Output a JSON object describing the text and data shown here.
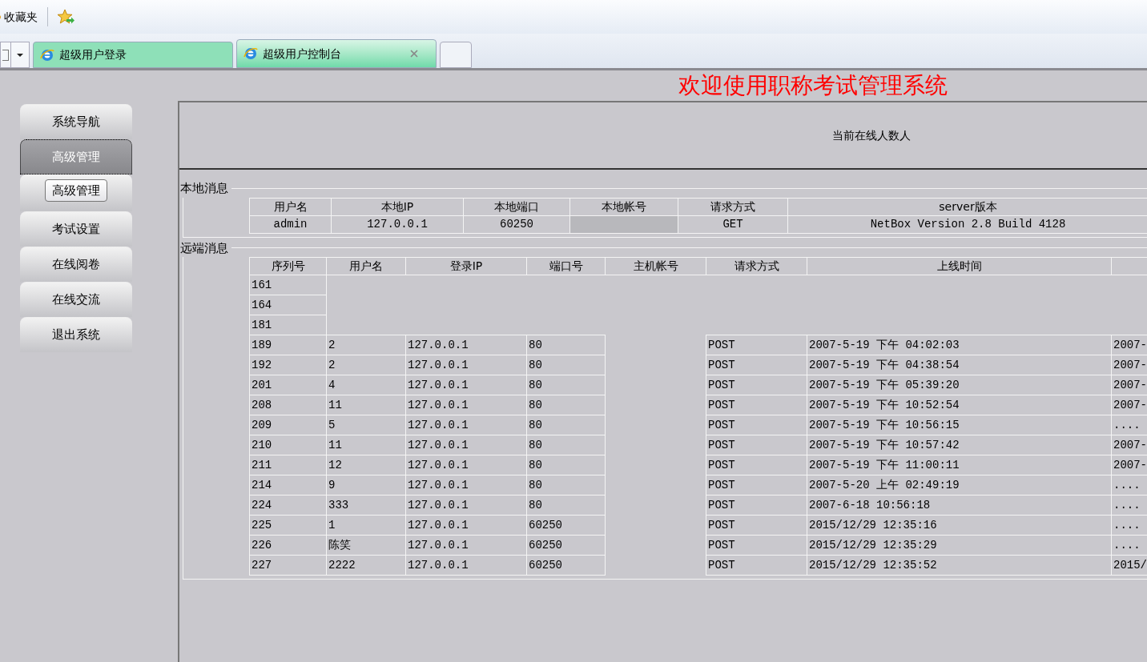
{
  "favorites_bar": {
    "label": "收藏夹"
  },
  "tabs": [
    {
      "label": "超级用户登录",
      "selected": false
    },
    {
      "label": "超级用户控制台",
      "selected": true
    }
  ],
  "page_title": "欢迎使用职称考试管理系统",
  "sidebar": {
    "items": [
      {
        "label": "系统导航",
        "selected": false
      },
      {
        "label": "高级管理",
        "selected": true,
        "children": [
          {
            "label": "高级管理"
          }
        ]
      },
      {
        "label": "考试设置",
        "selected": false
      },
      {
        "label": "在线阅卷",
        "selected": false
      },
      {
        "label": "在线交流",
        "selected": false
      },
      {
        "label": "退出系统",
        "selected": false
      }
    ]
  },
  "online_count": "当前在线人数人",
  "local_info": {
    "legend": "本地消息",
    "columns": [
      "用户名",
      "本地IP",
      "本地端口",
      "本地帐号",
      "请求方式",
      "server版本"
    ],
    "row": [
      {
        "kind": "text",
        "text": "admin"
      },
      {
        "kind": "text",
        "text": "127.0.0.1"
      },
      {
        "kind": "text",
        "text": "60250"
      },
      {
        "kind": "blank"
      },
      {
        "kind": "text",
        "text": "GET"
      },
      {
        "kind": "text",
        "text": "NetBox Version 2.8 Build 4128"
      }
    ]
  },
  "remote_info": {
    "legend": "远端消息",
    "columns": [
      "序列号",
      "用户名",
      "登录IP",
      "端口号",
      "主机帐号",
      "请求方式",
      "上线时间"
    ],
    "rows": [
      {
        "id": "161"
      },
      {
        "id": "164"
      },
      {
        "id": "181"
      },
      {
        "id": "189",
        "user": "2",
        "ip": "127.0.0.1",
        "port": "80",
        "method": "POST",
        "time": "2007-5-19 下午 04:02:03",
        "column_8": "2007-"
      },
      {
        "id": "192",
        "user": "2",
        "ip": "127.0.0.1",
        "port": "80",
        "method": "POST",
        "time": "2007-5-19 下午 04:38:54",
        "column_8": "2007-"
      },
      {
        "id": "201",
        "user": "4",
        "ip": "127.0.0.1",
        "port": "80",
        "method": "POST",
        "time": "2007-5-19 下午 05:39:20",
        "column_8": "2007-"
      },
      {
        "id": "208",
        "user": "11",
        "ip": "127.0.0.1",
        "port": "80",
        "method": "POST",
        "time": "2007-5-19 下午 10:52:54",
        "column_8": "2007-"
      },
      {
        "id": "209",
        "user": "5",
        "ip": "127.0.0.1",
        "port": "80",
        "method": "POST",
        "time": "2007-5-19 下午 10:56:15",
        "column_8": "...."
      },
      {
        "id": "210",
        "user": "11",
        "ip": "127.0.0.1",
        "port": "80",
        "method": "POST",
        "time": "2007-5-19 下午 10:57:42",
        "column_8": "2007-"
      },
      {
        "id": "211",
        "user": "12",
        "ip": "127.0.0.1",
        "port": "80",
        "method": "POST",
        "time": "2007-5-19 下午 11:00:11",
        "column_8": "2007-"
      },
      {
        "id": "214",
        "user": "9",
        "ip": "127.0.0.1",
        "port": "80",
        "method": "POST",
        "time": "2007-5-20 上午 02:49:19",
        "column_8": "...."
      },
      {
        "id": "224",
        "user": "333",
        "ip": "127.0.0.1",
        "port": "80",
        "method": "POST",
        "time": "2007-6-18 10:56:18",
        "column_8": "...."
      },
      {
        "id": "225",
        "user": "1",
        "ip": "127.0.0.1",
        "port": "60250",
        "method": "POST",
        "time": "2015/12/29 12:35:16",
        "column_8": "...."
      },
      {
        "id": "226",
        "user": "陈笑",
        "ip": "127.0.0.1",
        "port": "60250",
        "method": "POST",
        "time": "2015/12/29 12:35:29",
        "column_8": "...."
      },
      {
        "id": "227",
        "user": "2222",
        "ip": "127.0.0.1",
        "port": "60250",
        "method": "POST",
        "time": "2015/12/29 12:35:52",
        "column_8": "2015/"
      }
    ]
  }
}
